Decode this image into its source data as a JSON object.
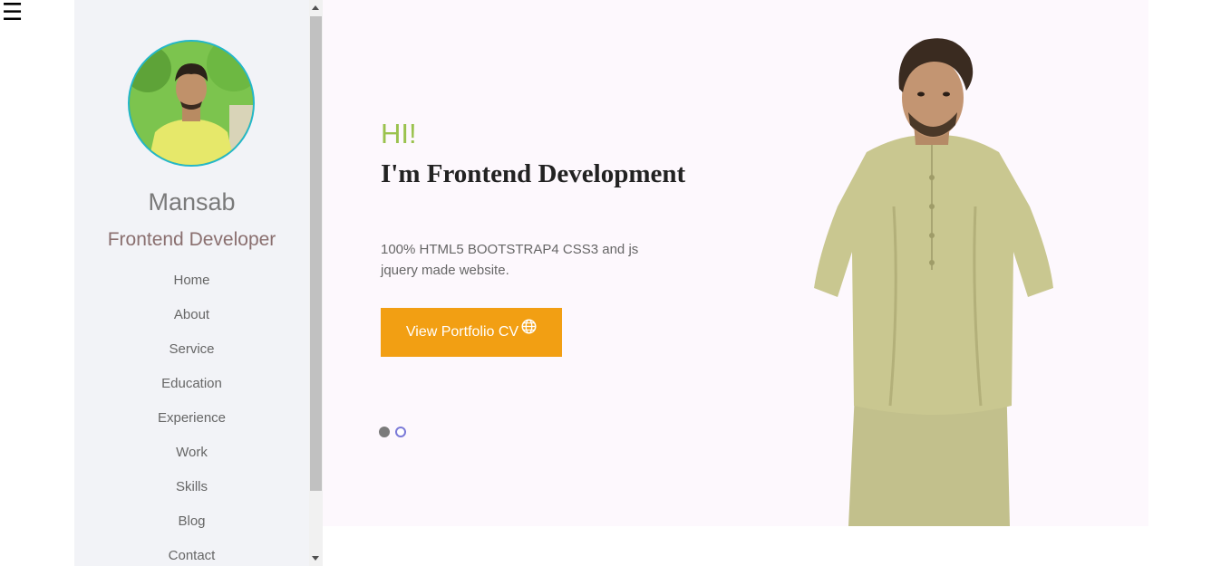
{
  "menu": {
    "icon": "hamburger-icon",
    "glyph": "☰"
  },
  "sidebar": {
    "name": "Mansab",
    "role": "Frontend Developer",
    "nav": [
      "Home",
      "About",
      "Service",
      "Education",
      "Experience",
      "Work",
      "Skills",
      "Blog",
      "Contact"
    ]
  },
  "hero": {
    "greeting": "HI!",
    "headline": "I'm Frontend Development",
    "description": "100% HTML5 BOOTSTRAP4 CSS3 and js jquery made website.",
    "cta_label": "View Portfolio CV",
    "cta_icon": "globe-icon",
    "slides": 2,
    "active_slide": 1
  },
  "colors": {
    "accent_green": "#9ac24d",
    "cta_orange": "#f29f13",
    "sidebar_bg": "#f2f3f7",
    "hero_bg": "#fdf8fd",
    "avatar_border": "#23b7c9"
  }
}
